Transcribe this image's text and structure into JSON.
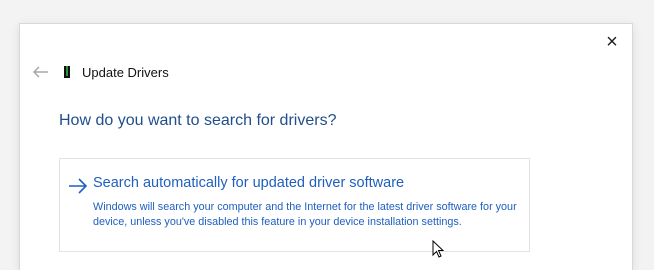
{
  "window": {
    "title": "Update Drivers",
    "close_label": "×"
  },
  "page": {
    "heading": "How do you want to search for drivers?"
  },
  "option": {
    "title": "Search automatically for updated driver software",
    "description": "Windows will search your computer and the Internet for the latest driver software for your device, unless you've disabled this feature in your device installation settings."
  },
  "icons": {
    "back": "back-arrow-icon",
    "app": "device-driver-icon",
    "option_arrow": "right-arrow-icon",
    "cursor": "mouse-pointer-icon"
  },
  "colors": {
    "heading": "#1f4e8c",
    "link": "#1f5fbf",
    "border": "#e2e2e2"
  }
}
